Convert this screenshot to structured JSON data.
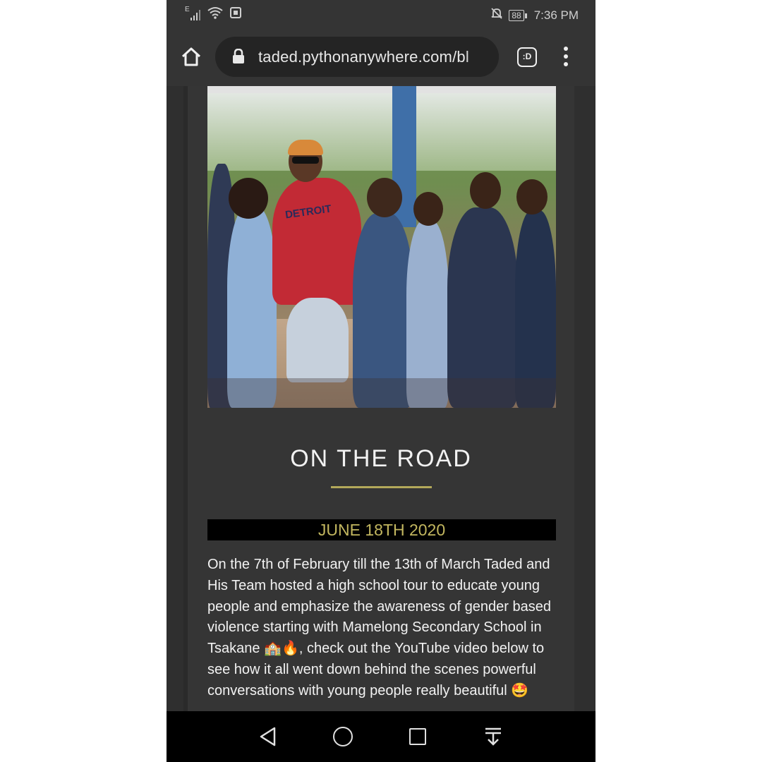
{
  "status_bar": {
    "network": "E",
    "battery": "88",
    "time": "7:36 PM"
  },
  "browser": {
    "url": "taded.pythonanywhere.com/bl",
    "dex_label": ":D"
  },
  "post": {
    "title": "ON THE ROAD",
    "date": "JUNE 18TH 2020",
    "body": "On the 7th of February till the 13th of March Taded and His Team hosted a high school tour to educate young people and emphasize the awareness of gender based violence starting with Mamelong Secondary School in Tsakane 🏫🔥, check out the YouTube video below to see how it all went down behind the scenes powerful conversations with young people really beautiful 🤩",
    "photo_shirt_text": "DETROIT",
    "accent_color": "#b3a85a"
  }
}
